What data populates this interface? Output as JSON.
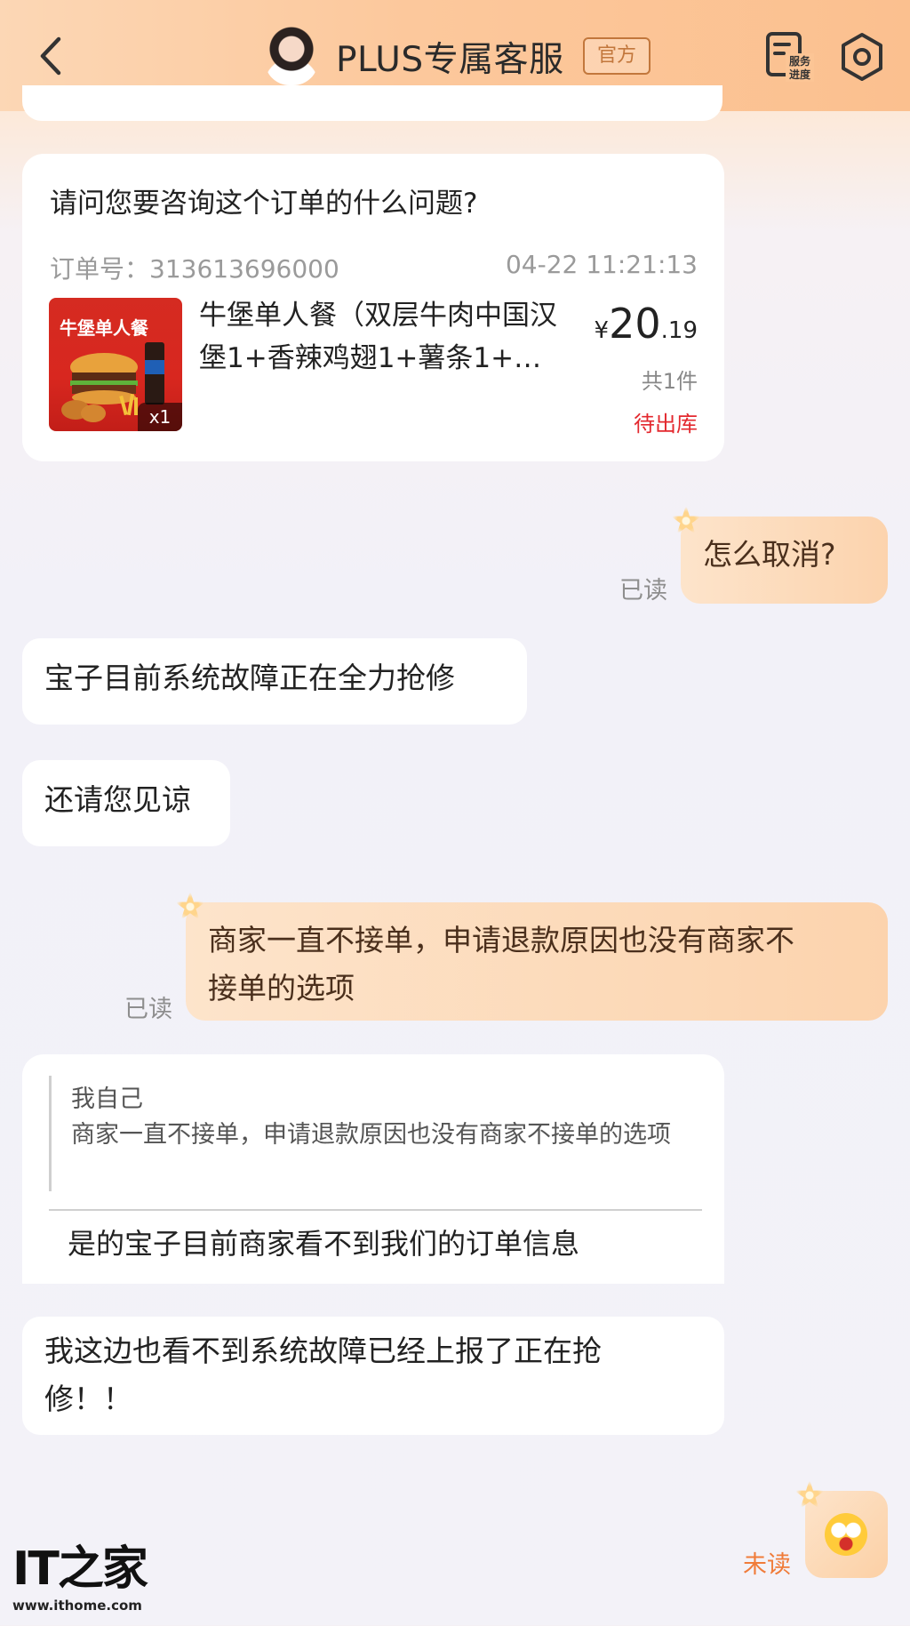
{
  "header": {
    "title": "PLUS专属客服",
    "badge": "官方",
    "service_progress_label": "服务进度"
  },
  "order_card": {
    "question": "请问您要咨询这个订单的什么问题?",
    "order_number": "订单号：313613696000",
    "order_time": "04-22 11:21:13",
    "thumbnail_title": "牛堡单人餐",
    "quantity_badge": "x1",
    "product_name": "牛堡单人餐（双层牛肉中国汉堡1+香辣鸡翅1+薯条1+…",
    "price_symbol": "¥",
    "price_integer": "20",
    "price_decimal": ".19",
    "item_count": "共1件",
    "status": "待出库"
  },
  "messages": [
    {
      "side": "right",
      "text": "怎么取消?",
      "read_status": "已读"
    },
    {
      "side": "left",
      "text": "宝子目前系统故障正在全力抢修"
    },
    {
      "side": "left",
      "text": "还请您见谅"
    },
    {
      "side": "right",
      "text_line1": "商家一直不接单，申请退款原因也没有商家不",
      "text_line2": "接单的选项",
      "read_status": "已读"
    },
    {
      "side": "left",
      "quote_author": "我自己",
      "quote_text": "商家一直不接单，申请退款原因也没有商家不接单的选项",
      "text": "是的宝子目前商家看不到我们的订单信息"
    },
    {
      "side": "left",
      "text_line1": "我这边也看不到系统故障已经上报了正在抢",
      "text_line2": "修！！"
    },
    {
      "side": "right",
      "emoji": "crying-face",
      "read_status": "未读"
    }
  ],
  "watermark": {
    "logo": "IT之家",
    "url": "www.ithome.com"
  },
  "colors": {
    "accent_orange": "#f07c3a",
    "status_red": "#e3282e",
    "official_badge": "#c2773c"
  }
}
